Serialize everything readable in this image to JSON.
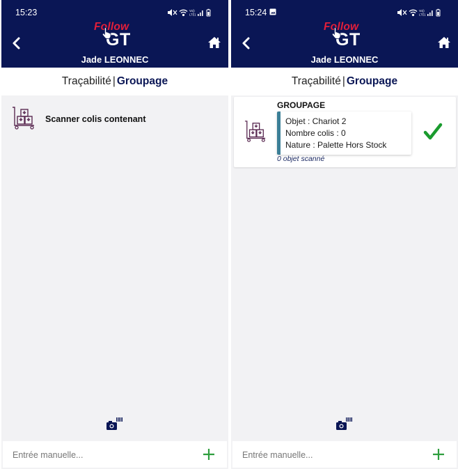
{
  "colors": {
    "header": "#0a1655",
    "accent_red": "#e21e3a",
    "check_green": "#1a9b2e",
    "info_bar": "#3b7f97",
    "plus_green": "#2e9e3e"
  },
  "screens": [
    {
      "status": {
        "time": "15:23",
        "icons": [
          "mute-icon",
          "wifi-icon",
          "volte-icon",
          "signal-icon",
          "battery-icon"
        ],
        "volte_label": "VoLTE1"
      },
      "header": {
        "logo_follow": "Follow",
        "logo_gt": "GT",
        "user_name": "Jade LEONNEC"
      },
      "tabs": {
        "first": "Traçabilité",
        "separator": "|",
        "second": "Groupage"
      },
      "scan_action": {
        "label": "Scanner colis contenant",
        "icon": "trolley-boxes-icon"
      },
      "manual_entry": {
        "placeholder": "Entrée manuelle...",
        "value": ""
      },
      "icons": {
        "back": "chevron-left-icon",
        "home": "home-icon",
        "camera": "camera-barcode-icon",
        "add": "plus-icon"
      }
    },
    {
      "status": {
        "time": "15:24",
        "icons": [
          "photo-icon",
          "mute-icon",
          "wifi-icon",
          "volte-icon",
          "signal-icon",
          "battery-icon"
        ],
        "volte_label": "VoLTE1"
      },
      "header": {
        "logo_follow": "Follow",
        "logo_gt": "GT",
        "user_name": "Jade LEONNEC"
      },
      "tabs": {
        "first": "Traçabilité",
        "separator": "|",
        "second": "Groupage"
      },
      "card": {
        "title": "GROUPAGE",
        "objet": "Objet : Chariot 2",
        "nombre_colis": "Nombre colis : 0",
        "nature": "Nature : Palette Hors Stock",
        "scanned_count": "0 objet scanné",
        "status_icon": "checkmark-icon",
        "icon": "trolley-boxes-icon"
      },
      "manual_entry": {
        "placeholder": "Entrée manuelle...",
        "value": ""
      },
      "icons": {
        "back": "chevron-left-icon",
        "home": "home-icon",
        "camera": "camera-barcode-icon",
        "add": "plus-icon"
      }
    }
  ]
}
